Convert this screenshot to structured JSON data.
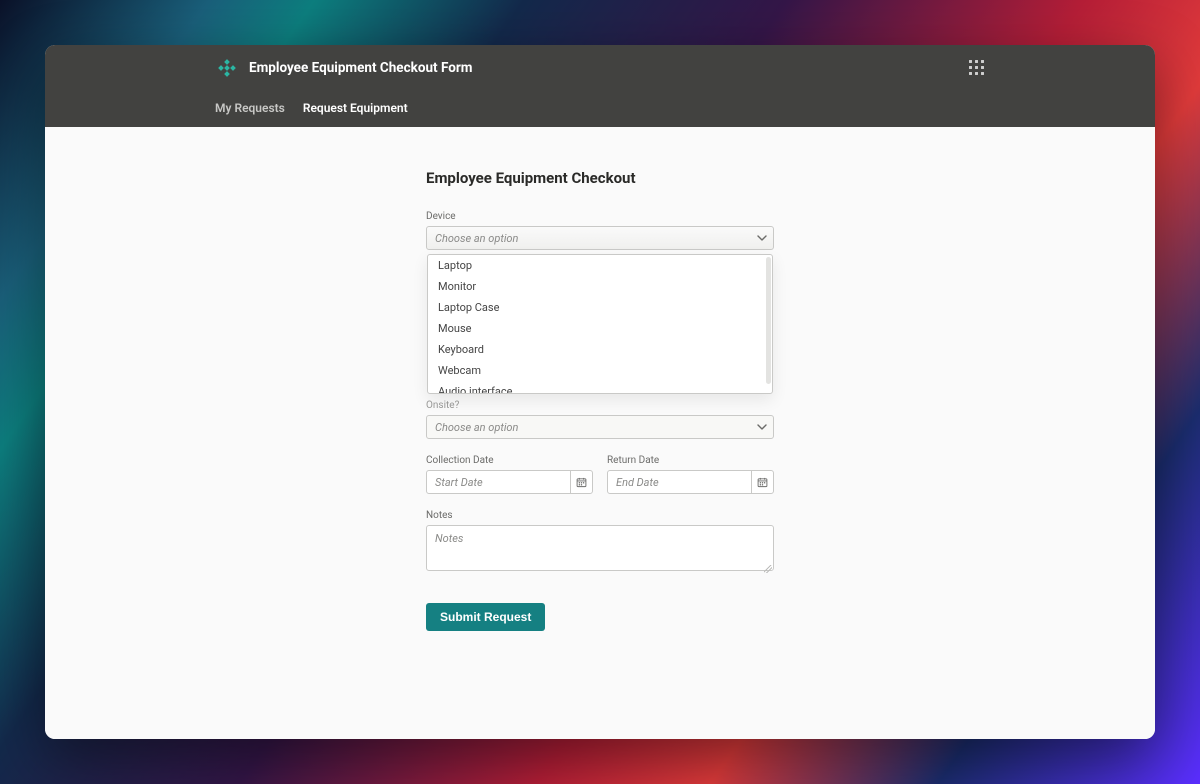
{
  "header": {
    "title": "Employee Equipment Checkout Form",
    "nav": {
      "my_requests": "My Requests",
      "request_equipment": "Request Equipment"
    }
  },
  "page": {
    "heading": "Employee Equipment Checkout"
  },
  "form": {
    "device": {
      "label": "Device",
      "placeholder": "Choose an option",
      "options": {
        "0": "Laptop",
        "1": "Monitor",
        "2": "Laptop Case",
        "3": "Mouse",
        "4": "Keyboard",
        "5": "Webcam",
        "6": "Audio interface"
      }
    },
    "onsite": {
      "label": "Onsite?",
      "placeholder": "Choose an option"
    },
    "collection_date": {
      "label": "Collection Date",
      "placeholder": "Start Date"
    },
    "return_date": {
      "label": "Return Date",
      "placeholder": "End Date"
    },
    "notes": {
      "label": "Notes",
      "placeholder": "Notes"
    },
    "submit_label": "Submit Request"
  },
  "icons": {
    "chevron_down": "chevron-down-icon",
    "calendar": "calendar-icon",
    "apps": "apps-grid-icon",
    "logo": "logo-icon"
  },
  "colors": {
    "accent": "#158082",
    "header_bg": "#424240"
  }
}
